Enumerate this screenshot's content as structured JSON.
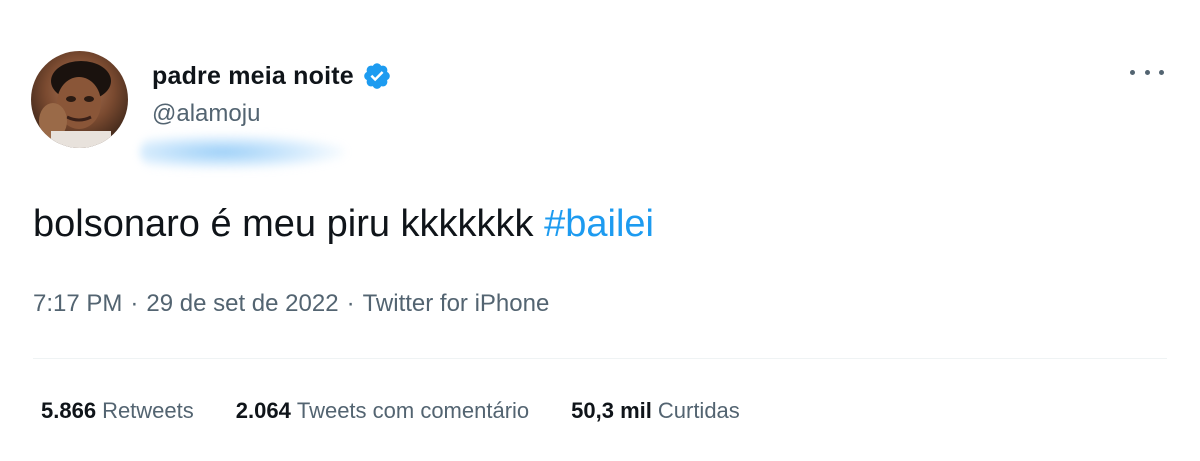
{
  "author": {
    "display_name": "padre meia noite",
    "handle": "@alamoju",
    "verified": true,
    "verified_color": "#1d9bf0",
    "avatar_icon": "avatar-photo"
  },
  "tweet": {
    "text": "bolsonaro é meu piru kkkkkkk ",
    "hashtag": "#bailei",
    "hashtag_color": "#1d9bf0"
  },
  "meta": {
    "time": "7:17 PM",
    "separator": "·",
    "date": "29 de set de 2022",
    "source": "Twitter for iPhone"
  },
  "stats": {
    "retweets_count": "5.866",
    "retweets_label": "Retweets",
    "quotes_count": "2.064",
    "quotes_label": "Tweets com comentário",
    "likes_count": "50,3 mil",
    "likes_label": "Curtidas"
  },
  "menu": {
    "more_icon": "more-horizontal-icon"
  }
}
